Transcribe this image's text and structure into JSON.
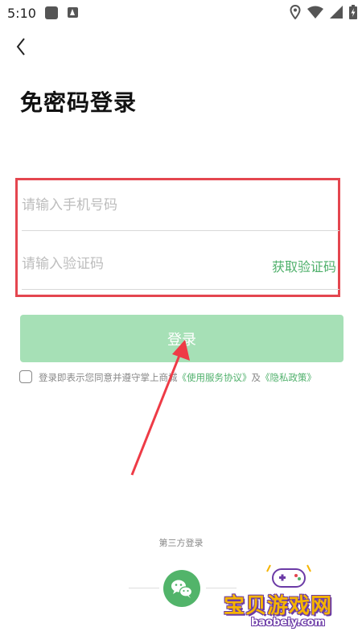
{
  "status_bar": {
    "time": "5:10"
  },
  "header": {
    "title": "免密码登录"
  },
  "form": {
    "phone_placeholder": "请输入手机号码",
    "code_placeholder": "请输入验证码",
    "get_code_label": "获取验证码"
  },
  "login_button": {
    "label": "登录"
  },
  "agreement": {
    "checked": false,
    "text": "登录即表示您同意并遵守掌上商城",
    "service_link": "《使用服务协议》",
    "conjunction": "及",
    "privacy_link": "《隐私政策》"
  },
  "third_party": {
    "label": "第三方登录",
    "icon": "wechat-icon"
  },
  "watermark": {
    "text": "宝贝游戏网",
    "url": "baobeiy.com"
  },
  "colors": {
    "accent_green": "#4fb06b",
    "button_green_disabled": "#a6e0b6",
    "highlight_red": "#e4464f",
    "wechat_green": "#52b46a"
  }
}
